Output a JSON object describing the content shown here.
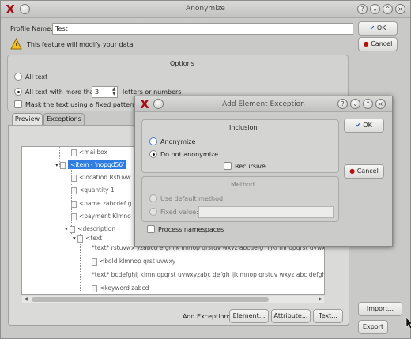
{
  "main": {
    "title": "Anonymize",
    "profile_label": "Profile Name:",
    "profile_value": "Test",
    "ok": "OK",
    "cancel": "Cancel",
    "warning": "This feature will modify your data",
    "options_title": "Options",
    "opt_all_text": "All text",
    "opt_more_than": "All text with more than",
    "opt_more_value": "3",
    "opt_letters": "letters or numbers",
    "opt_mask": "Mask the text using a fixed pattern",
    "tab_preview": "Preview",
    "tab_exceptions": "Exceptions",
    "add_exception": "Add Exception:",
    "btn_element": "Element...",
    "btn_attribute": "Attribute...",
    "btn_text": "Text...",
    "btn_import": "Import...",
    "btn_export": "Export"
  },
  "tree": {
    "rows": [
      "<mailbox",
      "<item - 'nopqd56'",
      "<location   Rstuvw",
      "<quantity   1",
      "<name   zabcdef g",
      "<payment   Klmno",
      "<description",
      "<text",
      "*text*   rstuvwx yzabcd efghijk lmnop qrstuv wxyz abcdefg hijkl mnopqrst uvwxy",
      "<bold   klmnop qrst uvwxy",
      "*text*   bcdefghij klmn opqrst uvwxyzabc defgh ijklmnop qrstuv wxyz abc defgh",
      "<keyword   zabcd"
    ]
  },
  "dialog": {
    "title": "Add Element Exception",
    "inclusion_title": "Inclusion",
    "opt_anonymize": "Anonymize",
    "opt_do_not": "Do not anonymize",
    "recursive": "Recursive",
    "method_title": "Method",
    "use_default": "Use default method",
    "fixed_value": "Fixed value:",
    "process_ns": "Process namespaces",
    "ok": "OK",
    "cancel": "Cancel"
  }
}
